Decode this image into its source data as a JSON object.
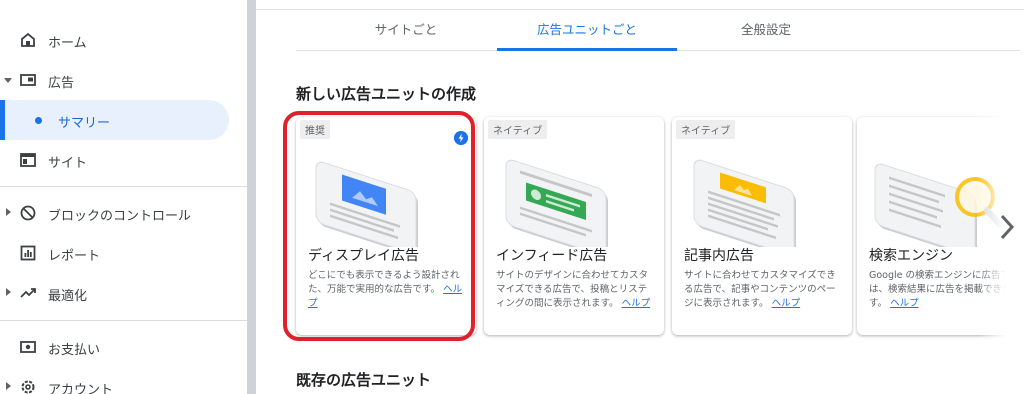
{
  "sidebar": {
    "items": [
      {
        "label": "ホーム",
        "icon": "home-icon"
      },
      {
        "label": "広告",
        "icon": "ad-units-icon"
      },
      {
        "label": "サマリー",
        "icon": "dot"
      },
      {
        "label": "サイト",
        "icon": "web-icon"
      },
      {
        "label": "ブロックのコントロール",
        "icon": "block-icon"
      },
      {
        "label": "レポート",
        "icon": "report-icon"
      },
      {
        "label": "最適化",
        "icon": "trending-up-icon"
      },
      {
        "label": "お支払い",
        "icon": "payments-icon"
      },
      {
        "label": "アカウント",
        "icon": "settings-icon"
      }
    ]
  },
  "tabs": [
    {
      "label": "サイトごと"
    },
    {
      "label": "広告ユニットごと"
    },
    {
      "label": "全般設定"
    }
  ],
  "sections": {
    "new_title": "新しい広告ユニットの作成",
    "existing_title": "既存の広告ユニット"
  },
  "cards": [
    {
      "badge": "推奨",
      "title": "ディスプレイ広告",
      "desc": "どこにでも表示できるよう設計された、万能で実用的な広告です。",
      "help": "ヘルプ"
    },
    {
      "badge": "ネイティブ",
      "title": "インフィード広告",
      "desc": "サイトのデザインに合わせてカスタマイズできる広告で、投稿とリスティングの間に表示されます。",
      "help": "ヘルプ"
    },
    {
      "badge": "ネイティブ",
      "title": "記事内広告",
      "desc": "サイトに合わせてカスタマイズできる広告で、記事やコンテンツのページに表示されます。",
      "help": "ヘルプ"
    },
    {
      "badge": "",
      "title": "検索エンジン",
      "desc": "Google の検索エンジンに広告では、検索結果に広告を掲載できます。",
      "help": "ヘルプ"
    }
  ],
  "colors": {
    "accent": "#1a73e8",
    "highlight": "#e0202a",
    "display_illus": "#4285f4",
    "infeed_illus": "#34a853",
    "article_illus": "#fbbc04"
  }
}
